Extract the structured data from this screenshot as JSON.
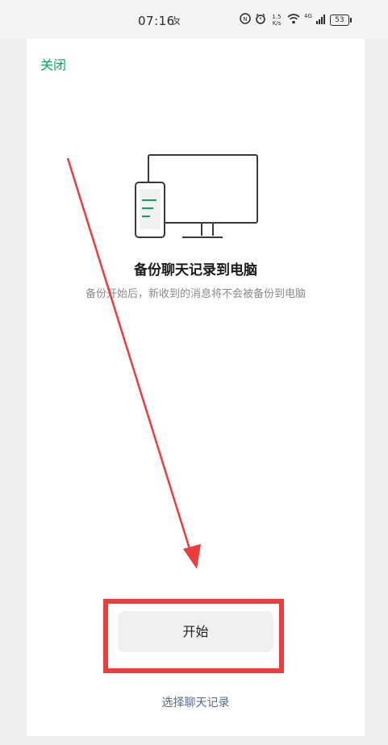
{
  "status_bar": {
    "time": "07:16",
    "net_speed_value": "1.5",
    "net_speed_unit": "K/s",
    "network_type": "4G",
    "battery": "53"
  },
  "sheet": {
    "close_label": "关闭",
    "title": "备份聊天记录到电脑",
    "subtitle": "备份开始后，新收到的消息将不会被备份到电脑",
    "start_button_label": "开始",
    "select_chats_label": "选择聊天记录"
  },
  "colors": {
    "accent_green": "#0aa65e",
    "link_blue": "#566a8f",
    "annotation_red": "#ee3b3b"
  }
}
